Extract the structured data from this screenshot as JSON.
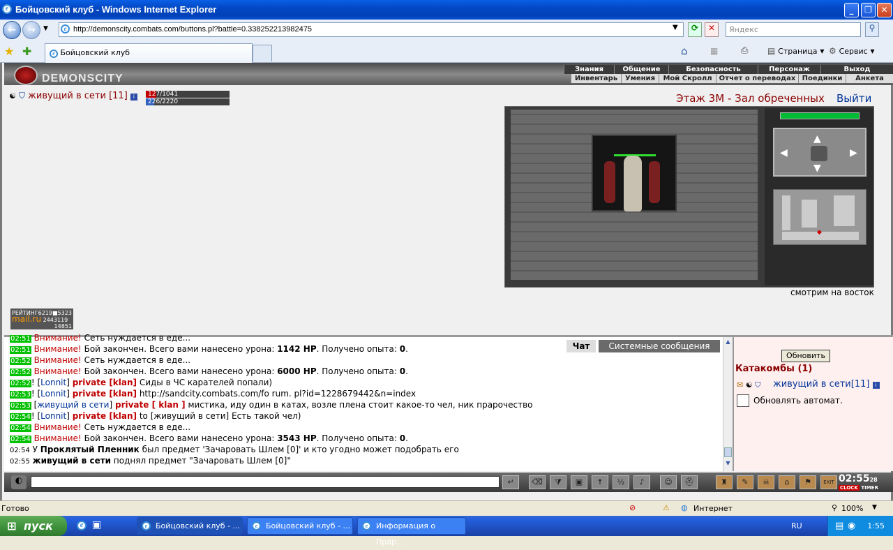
{
  "window": {
    "title": "Бойцовский клуб - Windows Internet Explorer"
  },
  "browser": {
    "url": "http://demonscity.combats.com/buttons.pl?battle=0.338252213982475",
    "search_placeholder": "Яндекс",
    "tab_label": "Бойцовский клуб",
    "page_menu": "Страница",
    "service_menu": "Сервис"
  },
  "game": {
    "logo": "DEMONSCITY",
    "menu_top": [
      "Знания",
      "Общение",
      "Безопасность",
      "Персонаж",
      "Выход"
    ],
    "menu_bottom": [
      "Инвентарь",
      "Умения",
      "Мой Скролл",
      "Отчет о переводах",
      "Поединки",
      "Анкета"
    ],
    "player": {
      "name": "живущий в сети",
      "level": "[11]",
      "hp": "127/1041",
      "mana": "226/2220",
      "hp_fraction": 0.122,
      "mana_fraction": 0.102
    },
    "location": "Этаж 3М - Зал обреченных",
    "exit": "Выйти",
    "facing": "смотрим на восток",
    "counter": {
      "line1": "РЕЙТИНГ6219■5323",
      "line2": "mail.ru",
      "line3": "2443119",
      "line4": "14851"
    }
  },
  "chat": {
    "tabs": [
      "Чат",
      "Системные сообщения"
    ],
    "lines": [
      {
        "time": "02:51",
        "warn": "Внимание!",
        "text": " Сеть нуждается в еде..."
      },
      {
        "time": "02:51",
        "warn": "Внимание!",
        "text": " Бой закончен. Всего вами нанесено урона: ",
        "b1": "1142 HP",
        "text2": ". Получено опыта: ",
        "b2": "0",
        "text3": "."
      },
      {
        "time": "02:52",
        "warn": "Внимание!",
        "text": " Сеть нуждается в еде..."
      },
      {
        "time": "02:52",
        "warn": "Внимание!",
        "text": " Бой закончен. Всего вами нанесено урона: ",
        "b1": "6000 HP",
        "text2": ". Получено опыта: ",
        "b2": "0",
        "text3": "."
      },
      {
        "time": "02:52",
        "pre": "! [",
        "who": "Lonnit",
        "post": "] ",
        "priv": "private [klan]",
        "text": " Сиды в ЧС карателей попали)"
      },
      {
        "time": "02:53",
        "pre": "! [",
        "who": "Lonnit",
        "post": "] ",
        "priv": "private [klan]",
        "text": " http://sandcity.combats.com/fo rum. pl?id=1228679442&n=index"
      },
      {
        "time": "02:53",
        "pre": " [",
        "who": "живущий в сети",
        "post": "] ",
        "priv": "private [ klan ]",
        "text": " мистика, иду один в катах, возле плена стоит какое-то чел, ник пpaрочество"
      },
      {
        "time": "02:54",
        "pre": "! [",
        "who": "Lonnit",
        "post": "] ",
        "priv": "private [klan]",
        "text": " to [живущий в сети] Есть такой чел)"
      },
      {
        "time": "02:54",
        "warn": "Внимание!",
        "text": " Сеть нуждается в еде..."
      },
      {
        "time": "02:54",
        "warn": "Внимание!",
        "text": " Бой закончен. Всего вами нанесено урона: ",
        "b1": "3543 HP",
        "text2": ". Получено опыта: ",
        "b2": "0",
        "text3": "."
      },
      {
        "time": "02:54",
        "plain": " У ",
        "b1": "Проклятый Пленник",
        "text": " был предмет 'Зачаровать Шлем [0]' и кто угодно может подобрать его"
      },
      {
        "time": "02:55",
        "plain": " ",
        "b1": "живущий в сети",
        "text": " поднял предмет \"Зачаровать Шлем [0]\""
      }
    ]
  },
  "side": {
    "refresh": "Обновить",
    "catacombs": "Катакомбы (1)",
    "player": "живущий в сети",
    "level": "[11]",
    "auto_refresh": "Обновлять автомат."
  },
  "clock": {
    "time": "02:55",
    "sec": "28",
    "label1": "CLOCK",
    "label2": "TIMER"
  },
  "status": {
    "left": "Готово",
    "zone": "Интернет",
    "zoom": "100%"
  },
  "taskbar": {
    "start": "пуск",
    "tasks": [
      "Бойцовский клуб - ...",
      "Бойцовский клуб - ...",
      "Информация о Прар..."
    ],
    "lang": "RU",
    "time": "1:55"
  }
}
